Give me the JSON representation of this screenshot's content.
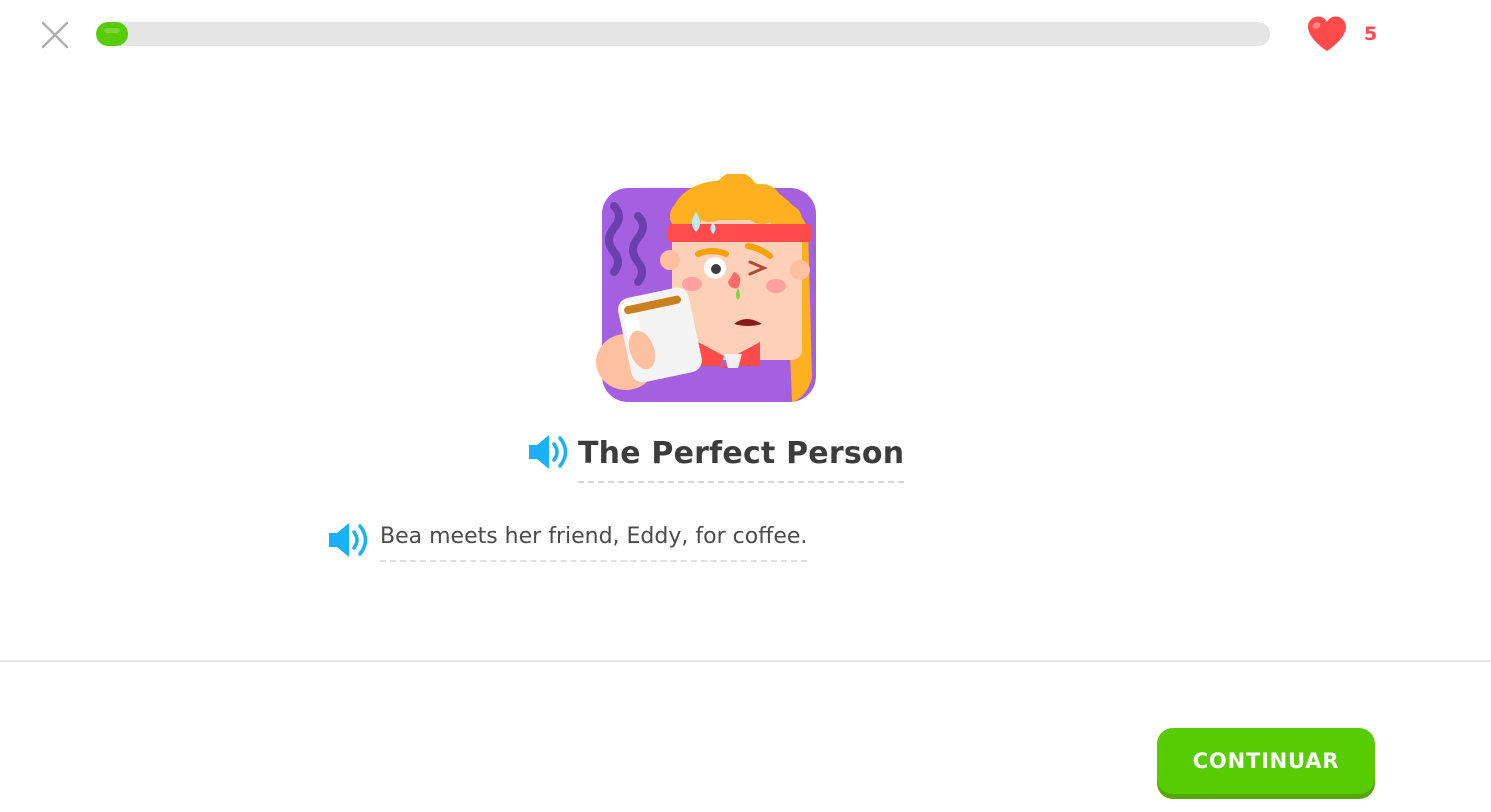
{
  "header": {
    "close_icon": "close-icon",
    "progress": {
      "percent": 2.7,
      "color": "#58cc02",
      "track_color": "#e5e5e5"
    },
    "hearts": {
      "icon": "heart-icon",
      "count": "5",
      "color": "#ff4b4b"
    }
  },
  "story": {
    "illustration": "story-illustration",
    "title": "The Perfect Person",
    "title_audio_icon": "speaker-icon",
    "lines": [
      {
        "text": "Bea meets her friend, Eddy, for coffee.",
        "audio_icon": "speaker-icon"
      }
    ]
  },
  "footer": {
    "continue_label": "CONTINUAR",
    "button_color": "#58cc02"
  },
  "colors": {
    "accent_green": "#58cc02",
    "speaker_blue": "#1cb0f6",
    "heart_red": "#ff4b4b",
    "illustration_purple": "#a560e0"
  }
}
